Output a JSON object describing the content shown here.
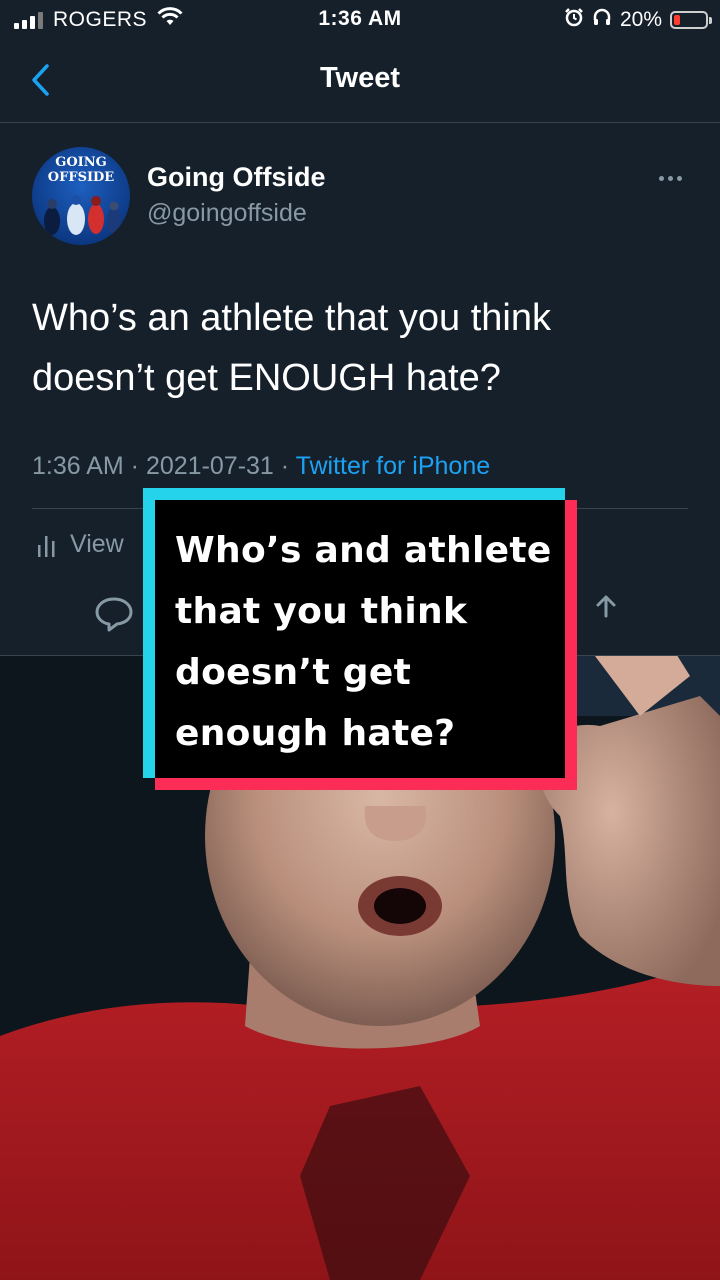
{
  "status_bar": {
    "carrier": "ROGERS",
    "time": "1:36 AM",
    "battery_percent": "20%",
    "battery_level": 0.2,
    "icons": [
      "signal-icon",
      "wifi-icon",
      "alarm-icon",
      "headphones-icon",
      "battery-icon"
    ]
  },
  "nav": {
    "title": "Tweet",
    "back_icon": "chevron-left-icon"
  },
  "tweet": {
    "avatar_text_line1": "GOING",
    "avatar_text_line2": "OFFSIDE",
    "display_name": "Going Offside",
    "handle": "@goingoffside",
    "text": "Who’s an athlete that you think doesn’t get ENOUGH hate?",
    "time": "1:36 AM",
    "date": "2021-07-31",
    "separator": " · ",
    "source": "Twitter for iPhone",
    "view_activity": "View"
  },
  "caption": {
    "text_line1": "Who’s and athlete",
    "text_line2": "that you think",
    "text_line3": "doesn’t get",
    "text_line4": "enough hate?"
  },
  "colors": {
    "background": "#15202b",
    "link": "#1da1f2",
    "secondary_text": "#8899a6",
    "caption_cyan": "#25d4ea",
    "caption_red": "#fb2c55",
    "battery_low": "#ff3b30"
  }
}
